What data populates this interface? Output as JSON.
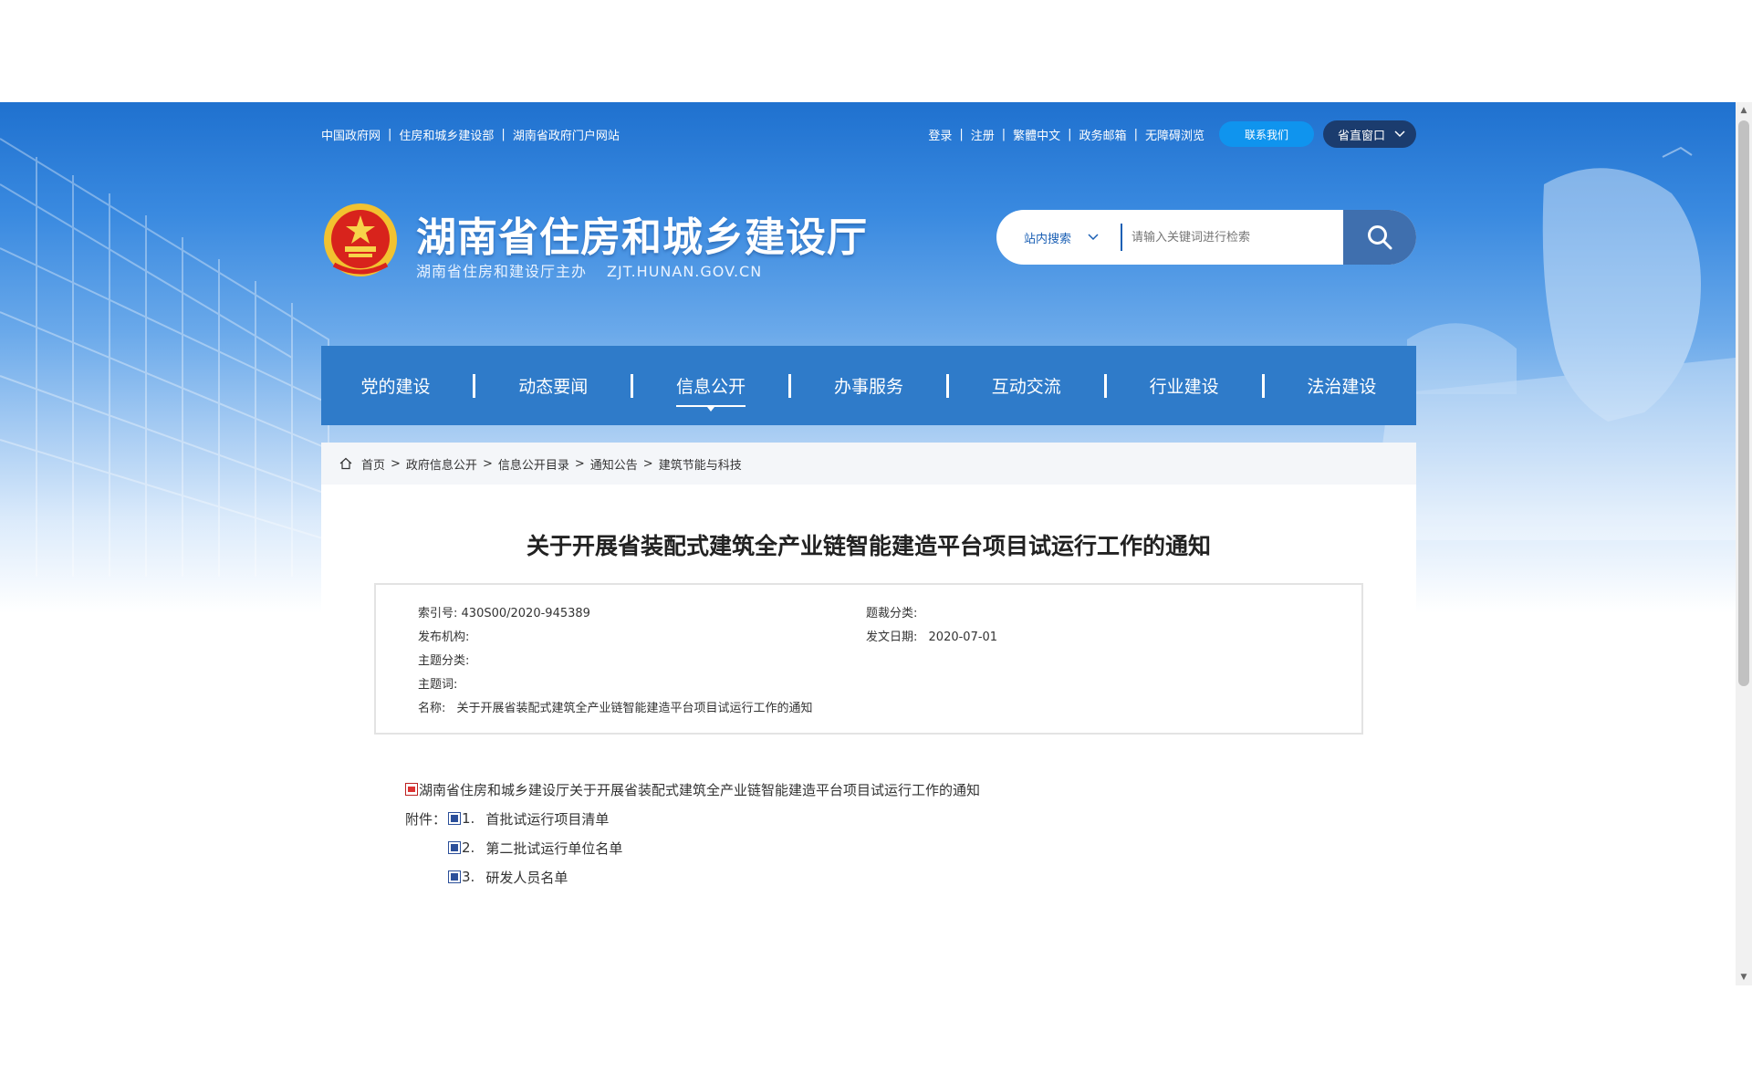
{
  "top_links": {
    "left": [
      "中国政府网",
      "住房和城乡建设部",
      "湖南省政府门户网站"
    ],
    "right": [
      "登录",
      "注册",
      "繁體中文",
      "政务邮箱",
      "无障碍浏览"
    ],
    "contact_button": "联系我们",
    "window_dropdown": "省直窗口"
  },
  "header": {
    "site_title": "湖南省住房和城乡建设厅",
    "subtitle": "湖南省住房和建设厅主办",
    "domain": "ZJT.HUNAN.GOV.CN"
  },
  "search": {
    "scope": "站内搜索",
    "placeholder": "请输入关键词进行检索"
  },
  "nav": {
    "items": [
      "党的建设",
      "动态要闻",
      "信息公开",
      "办事服务",
      "互动交流",
      "行业建设",
      "法治建设"
    ],
    "active": "信息公开"
  },
  "breadcrumb": [
    "首页",
    "政府信息公开",
    "信息公开目录",
    "通知公告",
    "建筑节能与科技"
  ],
  "article": {
    "title": "关于开展省装配式建筑全产业链智能建造平台项目试运行工作的通知",
    "meta": {
      "index_label": "索引号:",
      "index_value": "430S00/2020-945389",
      "genre_label": "题裁分类:",
      "genre_value": "",
      "publisher_label": "发布机构:",
      "publisher_value": "",
      "date_label": "发文日期:",
      "date_value": "2020-07-01",
      "topic_label": "主题分类:",
      "topic_value": "",
      "keywords_label": "主题词:",
      "keywords_value": "",
      "name_label": "名称:",
      "name_value": "关于开展省装配式建筑全产业链智能建造平台项目试运行工作的通知"
    },
    "main_file": "湖南省住房和城乡建设厅关于开展省装配式建筑全产业链智能建造平台项目试运行工作的通知",
    "attachments_label": "附件：",
    "attachments": [
      {
        "num": "1.",
        "name": "首批试运行项目清单"
      },
      {
        "num": "2.",
        "name": "第二批试运行单位名单"
      },
      {
        "num": "3.",
        "name": "研发人员名单"
      }
    ]
  },
  "colors": {
    "nav_bg": "#2f7bc9",
    "banner_top": "#1f71cf",
    "contact_pill": "#0f94ee",
    "window_pill": "#1b3c6e",
    "search_button": "#3f6fae"
  }
}
